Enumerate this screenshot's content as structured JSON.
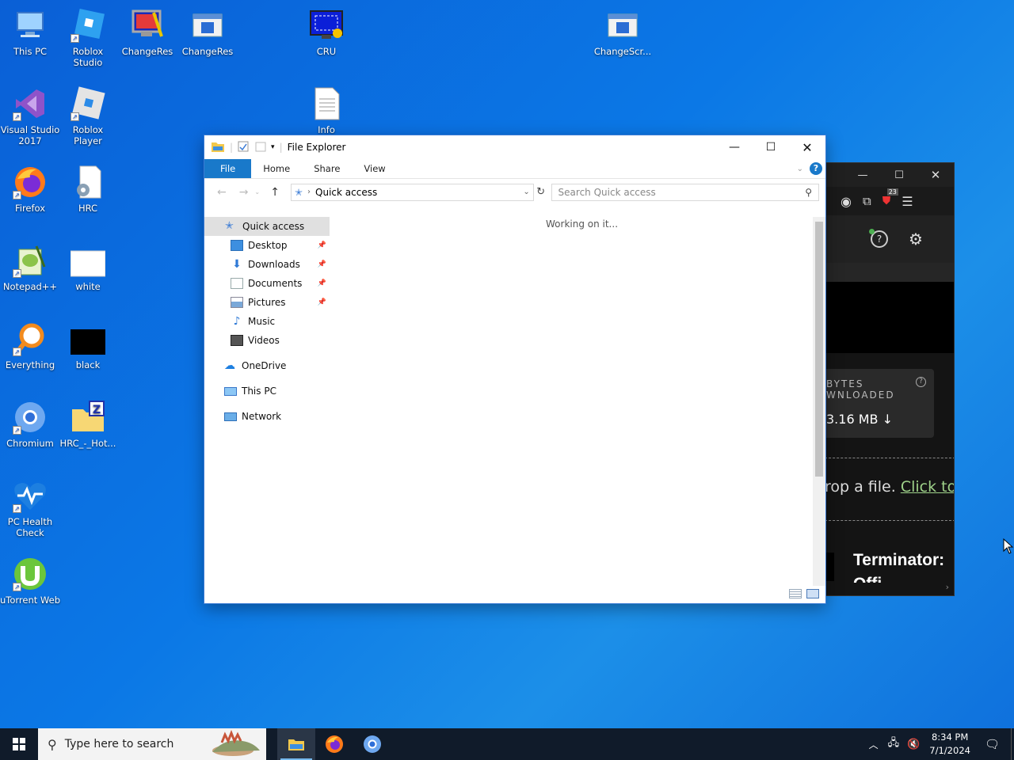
{
  "desktop": {
    "icons": [
      {
        "label": "This PC"
      },
      {
        "label": "Roblox Studio"
      },
      {
        "label": "ChangeRes"
      },
      {
        "label": "ChangeRes"
      },
      {
        "label": "CRU"
      },
      {
        "label": "ChangeScr..."
      },
      {
        "label": "Visual Studio 2017"
      },
      {
        "label": "Roblox Player"
      },
      {
        "label": "Info"
      },
      {
        "label": "Firefox"
      },
      {
        "label": "HRC"
      },
      {
        "label": "Notepad++"
      },
      {
        "label": "white"
      },
      {
        "label": "Everything"
      },
      {
        "label": "black"
      },
      {
        "label": "Chromium"
      },
      {
        "label": "HRC_-_Hot..."
      },
      {
        "label": "PC Health Check"
      },
      {
        "label": "uTorrent Web"
      }
    ]
  },
  "bg_app": {
    "badge_count": "23",
    "bytes_label_1": "BYTES",
    "bytes_label_2": "WNLOADED",
    "bytes_value": "3.16 MB",
    "drop_text": "rop a file.",
    "click_text": "Click to a",
    "item_title": "Terminator:",
    "item_sub": "Offi..."
  },
  "explorer": {
    "title": "File Explorer",
    "tabs": {
      "file": "File",
      "home": "Home",
      "share": "Share",
      "view": "View"
    },
    "address": "Quick access",
    "search_placeholder": "Search Quick access",
    "status": "Working on it...",
    "nav": {
      "quick_access": "Quick access",
      "desktop": "Desktop",
      "downloads": "Downloads",
      "documents": "Documents",
      "pictures": "Pictures",
      "music": "Music",
      "videos": "Videos",
      "onedrive": "OneDrive",
      "this_pc": "This PC",
      "network": "Network"
    }
  },
  "taskbar": {
    "search_placeholder": "Type here to search",
    "time": "8:34 PM",
    "date": "7/1/2024"
  }
}
